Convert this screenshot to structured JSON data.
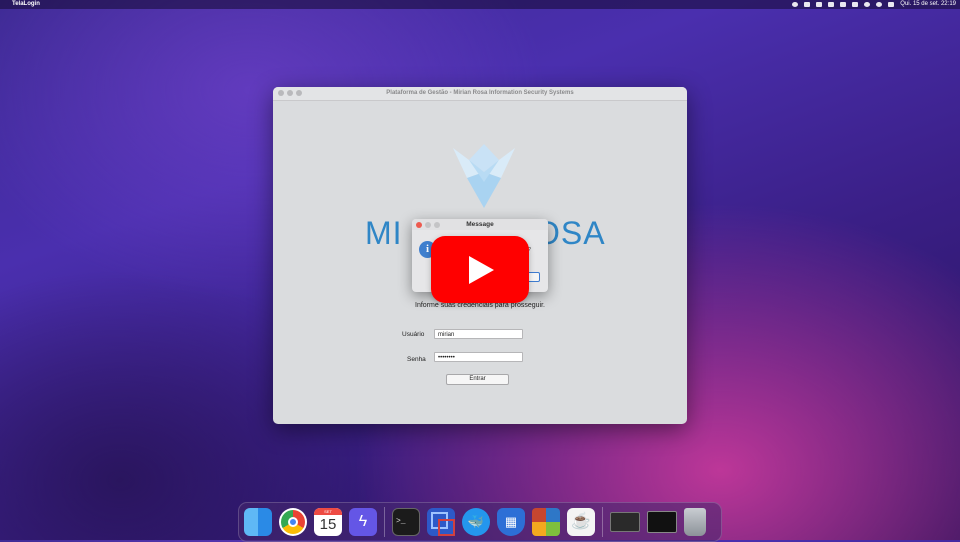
{
  "menubar": {
    "app_name": "TelaLogin",
    "datetime": "Qui. 15 de set.  22:19"
  },
  "window": {
    "title": "Plataforma de Gestão - Mirian Rosa Information Security Systems",
    "brand_left": "MI",
    "brand_right": "OSA",
    "subtitle": "Informe suas credenciais para prosseguir.",
    "username_label": "Usuário",
    "username_value": "mirian",
    "password_label": "Senha",
    "password_value": "••••••••",
    "login_button": "Entrar"
  },
  "dialog": {
    "title": "Message",
    "message_fragment": "to?"
  },
  "dock": {
    "calendar_month": "SET",
    "calendar_day": "15",
    "terminal_prompt": ">_"
  },
  "colors": {
    "youtube_red": "#ff0000",
    "brand_blue": "#2f86c6"
  },
  "icons": [
    "apple-icon",
    "play-icon",
    "info-icon",
    "finder-icon",
    "chrome-icon",
    "calendar-icon",
    "terminal-icon",
    "virtualbox-icon",
    "docker-icon",
    "trash-icon"
  ]
}
